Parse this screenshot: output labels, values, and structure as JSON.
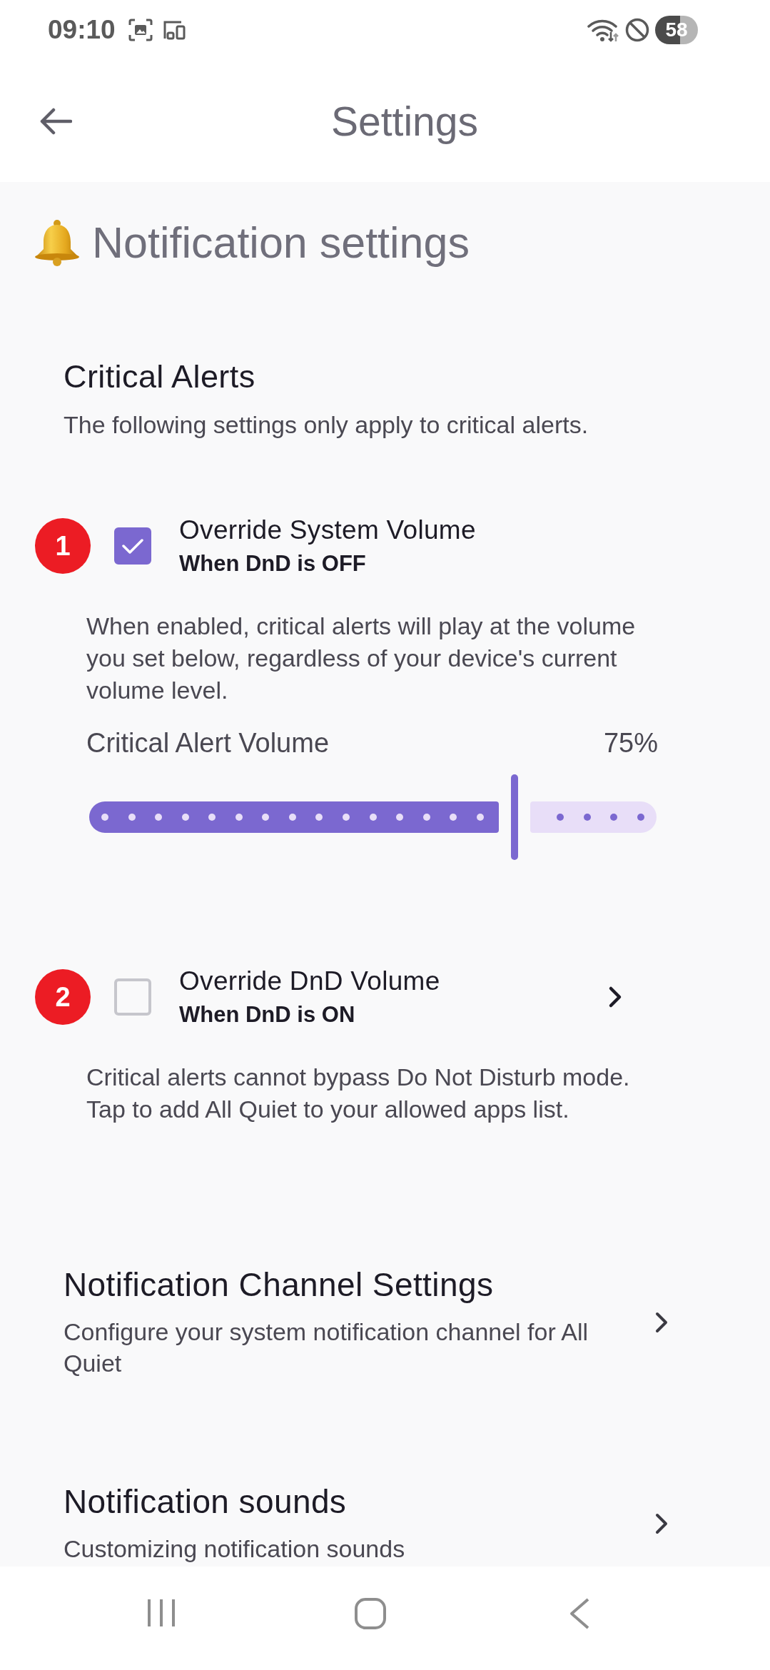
{
  "status_bar": {
    "time": "09:10",
    "battery": "58"
  },
  "app_bar": {
    "title": "Settings"
  },
  "page_heading": {
    "title": "Notification settings"
  },
  "critical_alerts": {
    "title": "Critical Alerts",
    "description": "The following settings only apply to critical alerts.",
    "options": [
      {
        "badge": "1",
        "title": "Override System Volume",
        "subtitle": "When DnD is OFF",
        "checked": true,
        "chevron": false,
        "description": "When enabled, critical alerts will play at the volume you set below, regardless of your device's current volume level.",
        "slider": {
          "label": "Critical Alert Volume",
          "reading": "75%",
          "level": 0.75
        }
      },
      {
        "badge": "2",
        "title": "Override DnD Volume",
        "subtitle": "When DnD is ON",
        "checked": false,
        "chevron": true,
        "description": "Critical alerts cannot bypass Do Not Disturb mode. Tap to add All Quiet to your allowed apps list."
      }
    ]
  },
  "links": [
    {
      "title": "Notification Channel Settings",
      "description": "Configure your system notification channel for All Quiet"
    },
    {
      "title": "Notification sounds",
      "description": "Customizing notification sounds"
    }
  ]
}
